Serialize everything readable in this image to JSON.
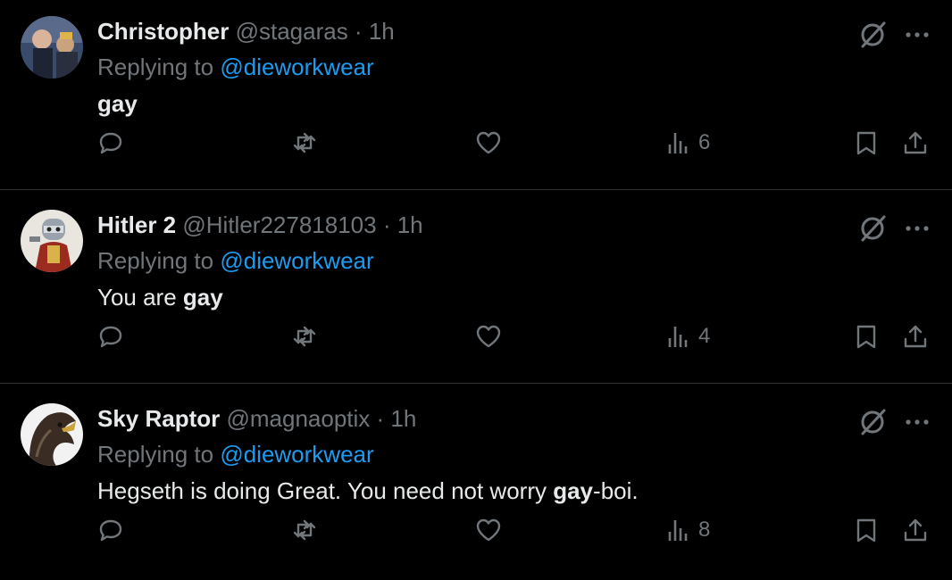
{
  "tweets": [
    {
      "name": "Christopher",
      "handle": "@stagaras",
      "time": "1h",
      "replying_prefix": "Replying to ",
      "replying_to": "@dieworkwear",
      "text_parts": [
        {
          "text": "gay",
          "bold": true
        }
      ],
      "views": "6"
    },
    {
      "name": "Hitler 2",
      "handle": "@Hitler227818103",
      "time": "1h",
      "replying_prefix": "Replying to ",
      "replying_to": "@dieworkwear",
      "text_parts": [
        {
          "text": "You are ",
          "bold": false
        },
        {
          "text": "gay",
          "bold": true
        }
      ],
      "views": "4"
    },
    {
      "name": "Sky Raptor",
      "handle": "@magnaoptix",
      "time": "1h",
      "replying_prefix": "Replying to ",
      "replying_to": "@dieworkwear",
      "text_parts": [
        {
          "text": "Hegseth is doing Great. You need not worry ",
          "bold": false
        },
        {
          "text": "gay",
          "bold": true
        },
        {
          "text": "-boi.",
          "bold": false
        }
      ],
      "views": "8"
    }
  ],
  "separator": " · ",
  "icons": [
    "reply-icon",
    "retweet-icon",
    "like-icon",
    "views-icon",
    "bookmark-icon",
    "share-icon",
    "grok-icon",
    "more-icon"
  ],
  "colors": {
    "background": "#000000",
    "text": "#e7e9ea",
    "muted": "#71767b",
    "link": "#1d9bf0",
    "divider": "#2f3336"
  }
}
